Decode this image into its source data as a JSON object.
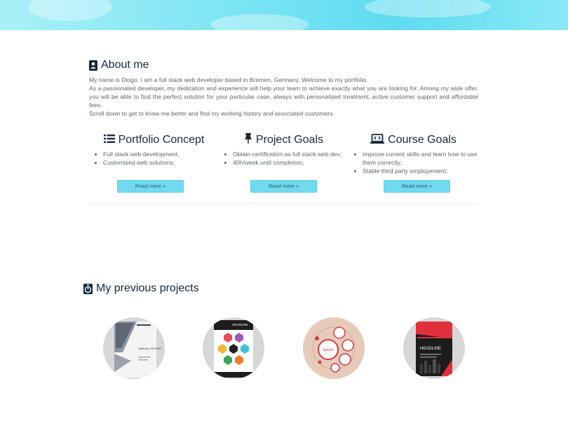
{
  "about": {
    "title": "About me",
    "icon": "user-card-icon",
    "paragraphs": [
      "My name is Diogo, I am a full stack web developer based in Bremen, Germany. Welcome to my portfolio.",
      "As a passionated developer, my dedication and experience will help your team to achieve exactly what you are looking for. Among my wide offer, you will be able to find the perfect solution for your particular case, always with personalised treatment, active customer support and affordable fees.",
      "Scroll down to get to know me better and find my working history and associated customers."
    ]
  },
  "columns": [
    {
      "title": "Portfolio Concept",
      "icon": "list-icon",
      "items": [
        "Full stack web development;",
        "Customised web solutions;"
      ],
      "button": "Read more »"
    },
    {
      "title": "Project Goals",
      "icon": "pushpin-icon",
      "items": [
        "Obtain certification as full stack web dev;",
        "40h/week until completion;"
      ],
      "button": "Read more »"
    },
    {
      "title": "Course Goals",
      "icon": "laptop-code-icon",
      "items": [
        "Improve current skills and learn how to use them correctly;",
        "Stable third party employement;"
      ],
      "button": "Read more »"
    }
  ],
  "projects": {
    "title": "My previous projects",
    "icon": "stopwatch-icon",
    "thumbnails": [
      {
        "name": "annual-report-thumbnail",
        "caption": "ANNUAL REPORT"
      },
      {
        "name": "infographic-poster-thumbnail",
        "caption": "HEADLINE"
      },
      {
        "name": "circle-infographic-thumbnail",
        "caption": "Splash"
      },
      {
        "name": "red-brochure-thumbnail",
        "caption": "HEADLINE"
      }
    ]
  },
  "colors": {
    "accent": "#6fdaf0",
    "heading": "#16283a",
    "text": "#5d666e"
  }
}
